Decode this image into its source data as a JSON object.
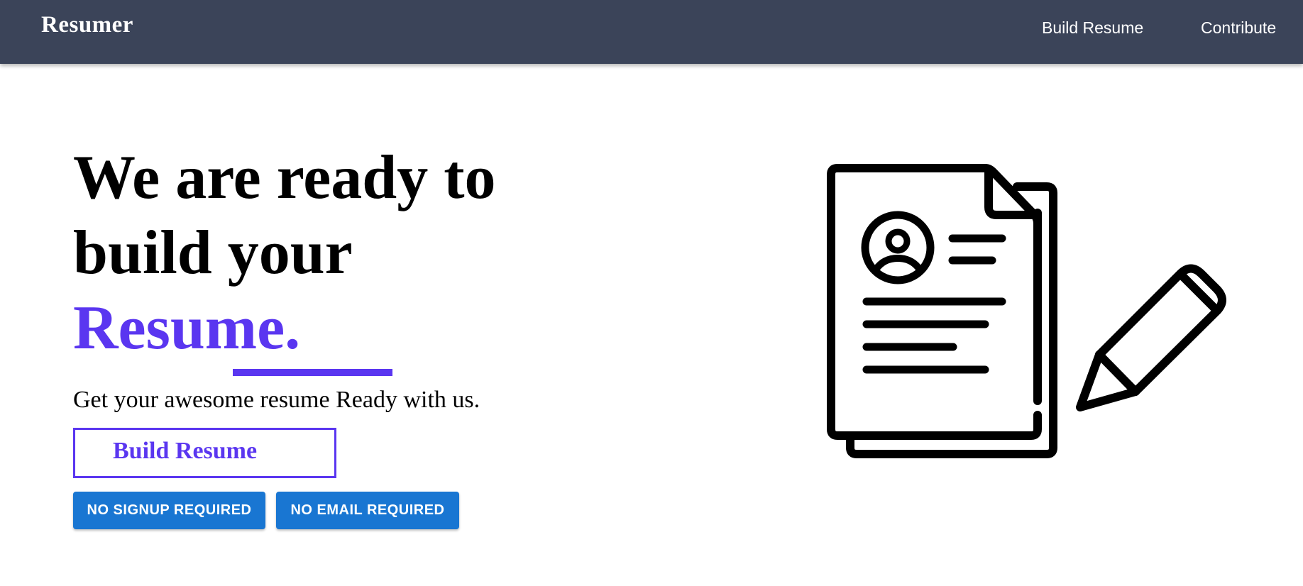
{
  "navbar": {
    "brand": "Resumer",
    "links": [
      {
        "label": "Build Resume"
      },
      {
        "label": "Contribute"
      }
    ],
    "background_color": "#3b4459"
  },
  "hero": {
    "title_line1": "We are ready to",
    "title_line2": "build your",
    "title_accent": "Resume.",
    "accent_color": "#5a36f0",
    "tagline": "Get your awesome resume Ready with us.",
    "cta_label": "Build Resume",
    "badges": [
      {
        "label": "NO SIGNUP REQUIRED"
      },
      {
        "label": "NO EMAIL REQUIRED"
      }
    ],
    "badge_color": "#1976d2"
  },
  "illustration": {
    "icon": "resume-document-with-pencil-icon"
  }
}
